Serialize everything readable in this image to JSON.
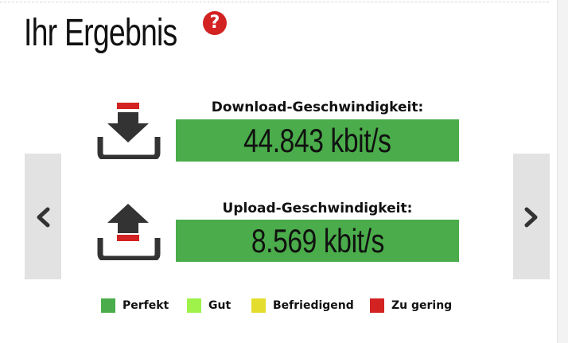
{
  "header": {
    "title": "Ihr Ergebnis",
    "help_icon": "help-question-icon",
    "help_symbol": "?"
  },
  "navigation": {
    "prev_icon": "chevron-left-icon",
    "next_icon": "chevron-right-icon"
  },
  "results": [
    {
      "label": "Download-Geschwindigkeit:",
      "value": "44.843 kbit/s",
      "icon": "download-icon",
      "rating_color": "#4aac4a"
    },
    {
      "label": "Upload-Geschwindigkeit:",
      "value": "8.569 kbit/s",
      "icon": "upload-icon",
      "rating_color": "#4aac4a"
    }
  ],
  "legend": [
    {
      "label": "Perfekt",
      "color": "#4aac4a"
    },
    {
      "label": "Gut",
      "color": "#9ef24a"
    },
    {
      "label": "Befriedigend",
      "color": "#e5dd2e"
    },
    {
      "label": "Zu gering",
      "color": "#d32222"
    }
  ],
  "colors": {
    "accent_red": "#d32222",
    "icon_dark": "#333333",
    "nav_bg": "#e2e2e2"
  }
}
